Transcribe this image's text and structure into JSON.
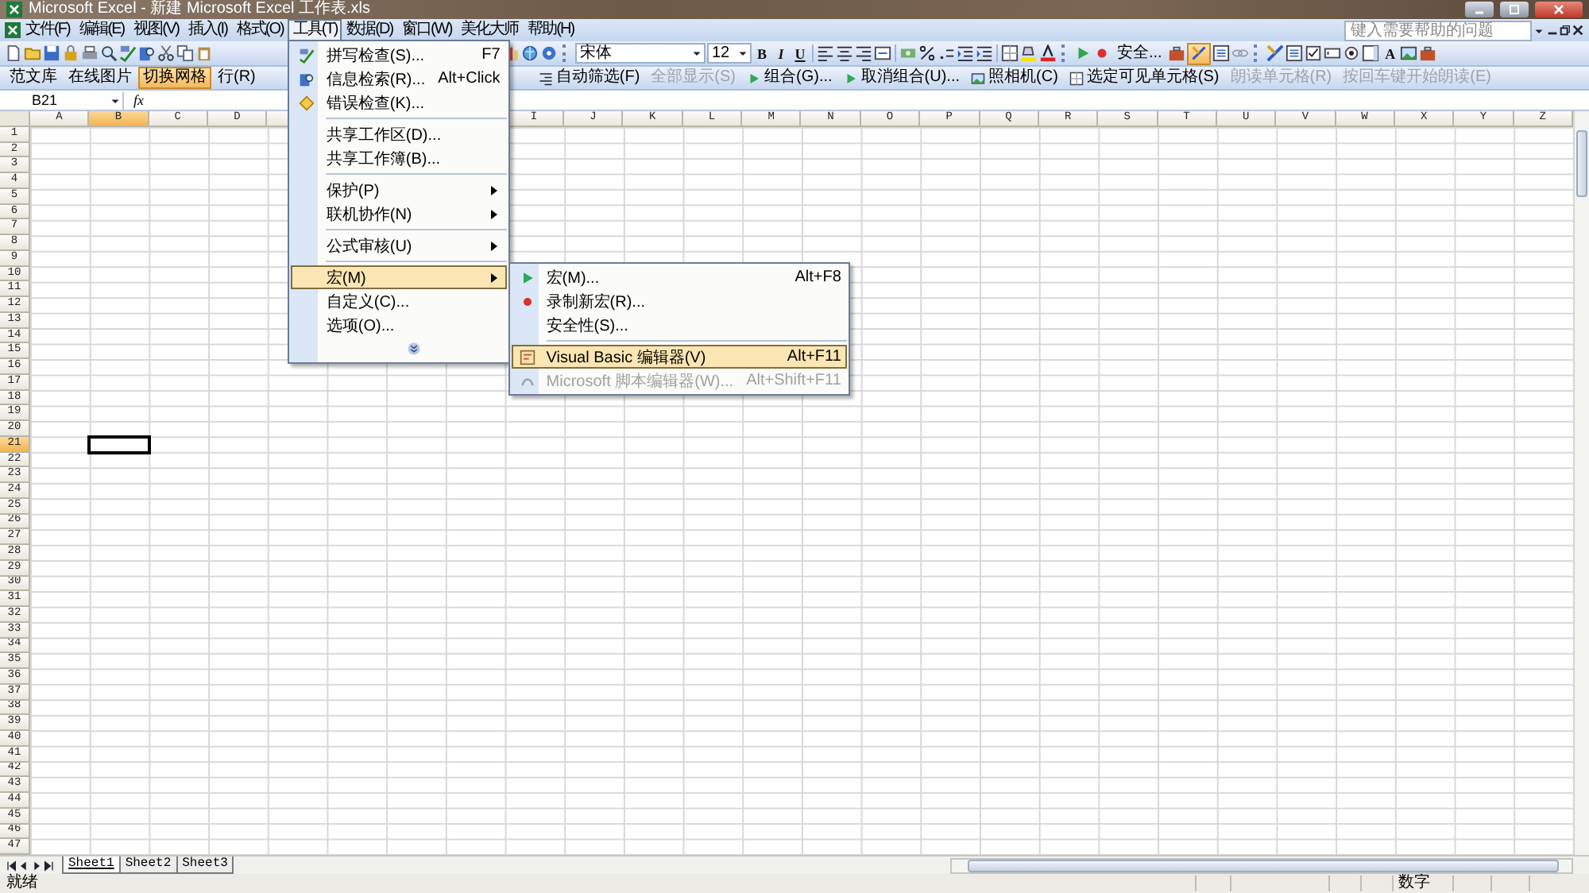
{
  "window": {
    "title": "Microsoft Excel - 新建 Microsoft Excel 工作表.xls"
  },
  "menu_bar": [
    {
      "label": "文件(F)",
      "selected": false
    },
    {
      "label": "编辑(E)",
      "selected": false
    },
    {
      "label": "视图(V)",
      "selected": false
    },
    {
      "label": "插入(I)",
      "selected": false
    },
    {
      "label": "格式(O)",
      "selected": false
    },
    {
      "label": "工具(T)",
      "selected": true
    },
    {
      "label": "数据(D)",
      "selected": false
    },
    {
      "label": "窗口(W)",
      "selected": false
    },
    {
      "label": "美化大师",
      "selected": false
    },
    {
      "label": "帮助(H)",
      "selected": false
    }
  ],
  "help_box": {
    "placeholder": "键入需要帮助的问题"
  },
  "toolbar": {
    "font": "宋体",
    "size": "12",
    "format_buttons": [
      "B",
      "I",
      "U"
    ],
    "security": "安全...",
    "design_mode_on": true,
    "label_tool": "A"
  },
  "toolbar2_left": [
    {
      "label": "范文库",
      "pressed": false,
      "disabled": false
    },
    {
      "label": "在线图片",
      "pressed": false,
      "disabled": false
    },
    {
      "label": "切换网格",
      "pressed": true,
      "disabled": false
    },
    {
      "label": "行(R)",
      "pressed": false,
      "disabled": false
    }
  ],
  "toolbar2_right": [
    {
      "label": "自动筛选(F)",
      "pressed": false,
      "disabled": false
    },
    {
      "label": "全部显示(S)",
      "pressed": false,
      "disabled": true
    },
    {
      "label": "组合(G)...",
      "pressed": false,
      "disabled": false
    },
    {
      "label": "取消组合(U)...",
      "pressed": false,
      "disabled": false
    },
    {
      "label": "照相机(C)",
      "pressed": false,
      "disabled": false
    },
    {
      "label": "选定可见单元格(S)",
      "pressed": false,
      "disabled": false
    },
    {
      "label": "朗读单元格(R)",
      "pressed": false,
      "disabled": true
    },
    {
      "label": "按回车键开始朗读(E)",
      "pressed": false,
      "disabled": true
    }
  ],
  "formula_bar": {
    "name_box": "B21",
    "function_label": "fx"
  },
  "tools_menu": [
    {
      "kind": "item",
      "label": "拼写检查(S)...",
      "shortcut": "F7",
      "submenu": false,
      "selected": false
    },
    {
      "kind": "item",
      "label": "信息检索(R)...",
      "shortcut": "Alt+Click",
      "submenu": false,
      "selected": false
    },
    {
      "kind": "item",
      "label": "错误检查(K)...",
      "submenu": false,
      "selected": false
    },
    {
      "kind": "separator"
    },
    {
      "kind": "item",
      "label": "共享工作区(D)...",
      "submenu": false,
      "selected": false
    },
    {
      "kind": "item",
      "label": "共享工作簿(B)...",
      "submenu": false,
      "selected": false
    },
    {
      "kind": "separator"
    },
    {
      "kind": "item",
      "label": "保护(P)",
      "submenu": true,
      "selected": false
    },
    {
      "kind": "item",
      "label": "联机协作(N)",
      "submenu": true,
      "selected": false
    },
    {
      "kind": "separator"
    },
    {
      "kind": "item",
      "label": "公式审核(U)",
      "submenu": true,
      "selected": false
    },
    {
      "kind": "separator"
    },
    {
      "kind": "item",
      "label": "宏(M)",
      "submenu": true,
      "selected": true
    },
    {
      "kind": "item",
      "label": "自定义(C)...",
      "submenu": false,
      "selected": false
    },
    {
      "kind": "item",
      "label": "选项(O)...",
      "submenu": false,
      "selected": false
    },
    {
      "kind": "expand"
    }
  ],
  "macro_submenu": [
    {
      "kind": "item",
      "label": "宏(M)...",
      "shortcut": "Alt+F8",
      "selected": false,
      "disabled": false
    },
    {
      "kind": "item",
      "label": "录制新宏(R)...",
      "selected": false,
      "disabled": false
    },
    {
      "kind": "item",
      "label": "安全性(S)...",
      "selected": false,
      "disabled": false
    },
    {
      "kind": "separator"
    },
    {
      "kind": "item",
      "label": "Visual Basic 编辑器(V)",
      "shortcut": "Alt+F11",
      "selected": true,
      "disabled": false
    },
    {
      "kind": "item",
      "label": "Microsoft 脚本编辑器(W)...",
      "shortcut": "Alt+Shift+F11",
      "selected": false,
      "disabled": true
    }
  ],
  "sheet": {
    "columns_left": [
      {
        "label": "A",
        "selected": false
      },
      {
        "label": "B",
        "selected": true
      },
      {
        "label": "C",
        "selected": false
      },
      {
        "label": "D",
        "selected": false
      }
    ],
    "columns_right": [
      {
        "label": "I",
        "selected": false
      },
      {
        "label": "J",
        "selected": false
      },
      {
        "label": "K",
        "selected": false
      },
      {
        "label": "L",
        "selected": false
      },
      {
        "label": "M",
        "selected": false
      },
      {
        "label": "N",
        "selected": false
      },
      {
        "label": "O",
        "selected": false
      },
      {
        "label": "P",
        "selected": false
      },
      {
        "label": "Q",
        "selected": false
      },
      {
        "label": "R",
        "selected": false
      },
      {
        "label": "S",
        "selected": false
      },
      {
        "label": "T",
        "selected": false
      },
      {
        "label": "U",
        "selected": false
      },
      {
        "label": "V",
        "selected": false
      },
      {
        "label": "W",
        "selected": false
      },
      {
        "label": "X",
        "selected": false
      },
      {
        "label": "Y",
        "selected": false
      },
      {
        "label": "Z",
        "selected": false
      }
    ],
    "rows": [
      {
        "label": "1",
        "selected": false
      },
      {
        "label": "2",
        "selected": false
      },
      {
        "label": "3",
        "selected": false
      },
      {
        "label": "4",
        "selected": false
      },
      {
        "label": "5",
        "selected": false
      },
      {
        "label": "6",
        "selected": false
      },
      {
        "label": "7",
        "selected": false
      },
      {
        "label": "8",
        "selected": false
      },
      {
        "label": "9",
        "selected": false
      },
      {
        "label": "10",
        "selected": false
      },
      {
        "label": "11",
        "selected": false
      },
      {
        "label": "12",
        "selected": false
      },
      {
        "label": "13",
        "selected": false
      },
      {
        "label": "14",
        "selected": false
      },
      {
        "label": "15",
        "selected": false
      },
      {
        "label": "16",
        "selected": false
      },
      {
        "label": "17",
        "selected": false
      },
      {
        "label": "18",
        "selected": false
      },
      {
        "label": "19",
        "selected": false
      },
      {
        "label": "20",
        "selected": false
      },
      {
        "label": "21",
        "selected": true
      },
      {
        "label": "22",
        "selected": false
      },
      {
        "label": "23",
        "selected": false
      },
      {
        "label": "24",
        "selected": false
      },
      {
        "label": "25",
        "selected": false
      },
      {
        "label": "26",
        "selected": false
      },
      {
        "label": "27",
        "selected": false
      },
      {
        "label": "28",
        "selected": false
      },
      {
        "label": "29",
        "selected": false
      },
      {
        "label": "30",
        "selected": false
      },
      {
        "label": "31",
        "selected": false
      },
      {
        "label": "32",
        "selected": false
      },
      {
        "label": "33",
        "selected": false
      },
      {
        "label": "34",
        "selected": false
      },
      {
        "label": "35",
        "selected": false
      },
      {
        "label": "36",
        "selected": false
      },
      {
        "label": "37",
        "selected": false
      },
      {
        "label": "38",
        "selected": false
      },
      {
        "label": "39",
        "selected": false
      },
      {
        "label": "40",
        "selected": false
      },
      {
        "label": "41",
        "selected": false
      },
      {
        "label": "42",
        "selected": false
      },
      {
        "label": "43",
        "selected": false
      },
      {
        "label": "44",
        "selected": false
      },
      {
        "label": "45",
        "selected": false
      },
      {
        "label": "46",
        "selected": false
      },
      {
        "label": "47",
        "selected": false
      }
    ]
  },
  "sheet_tabs": [
    {
      "label": "Sheet1",
      "selected": true
    },
    {
      "label": "Sheet2",
      "selected": false
    },
    {
      "label": "Sheet3",
      "selected": false
    }
  ],
  "status_bar": {
    "mode": "就绪",
    "indicator": "数字"
  }
}
